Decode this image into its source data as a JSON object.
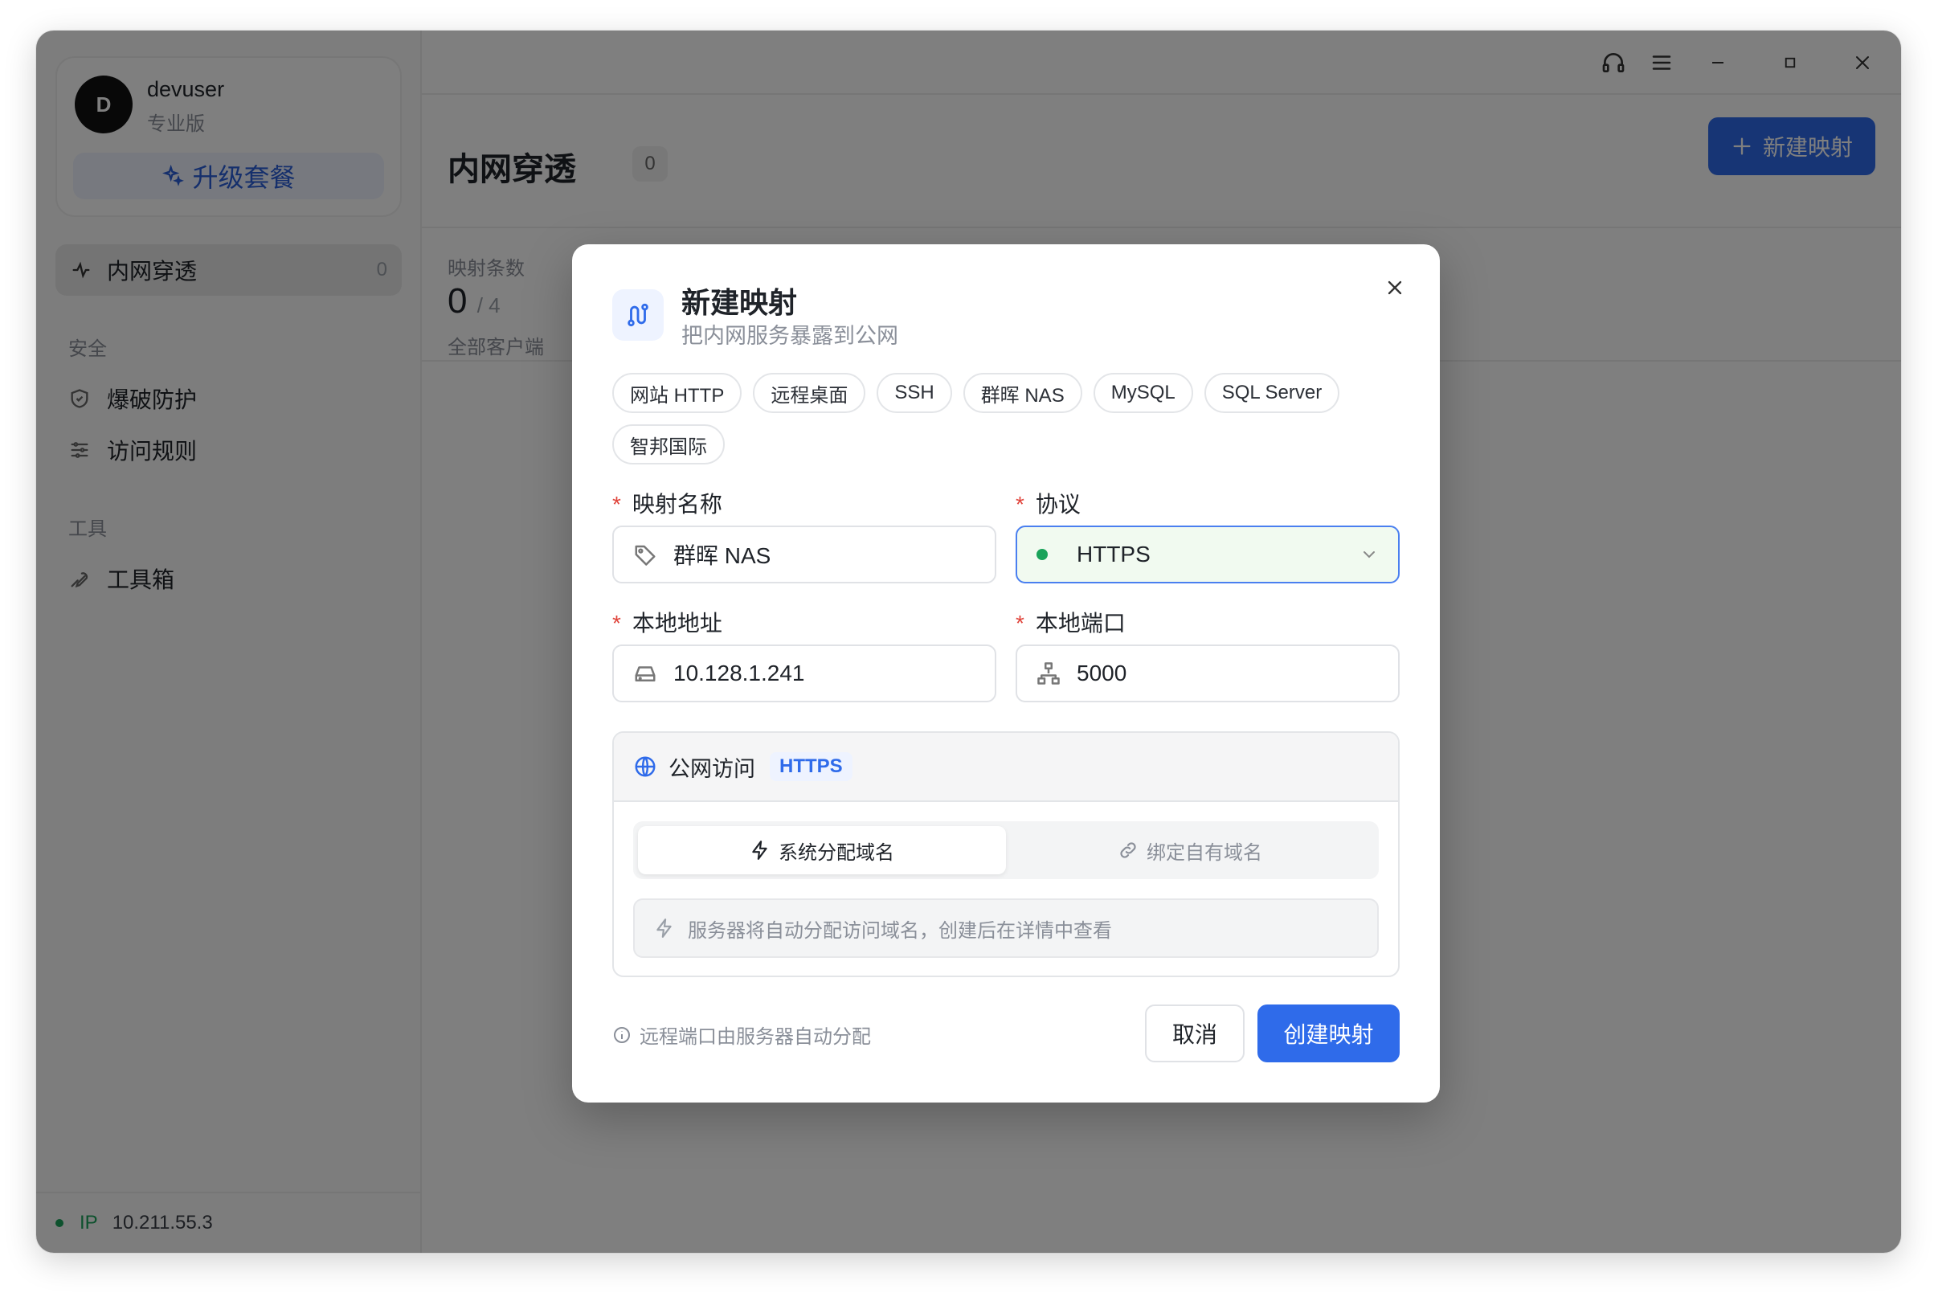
{
  "user": {
    "avatar_letter": "D",
    "name": "devuser",
    "plan": "专业版",
    "upgrade_label": "升级套餐"
  },
  "sidebar": {
    "active_item": {
      "label": "内网穿透",
      "count": "0"
    },
    "sections": [
      {
        "title": "安全",
        "items": [
          {
            "label": "爆破防护",
            "icon": "shield-icon"
          },
          {
            "label": "访问规则",
            "icon": "sliders-icon"
          }
        ]
      },
      {
        "title": "工具",
        "items": [
          {
            "label": "工具箱",
            "icon": "wrench-icon"
          }
        ]
      }
    ],
    "footer": {
      "ip_label": "IP",
      "ip_value": "10.211.55.3"
    }
  },
  "page": {
    "title": "内网穿透",
    "count": "0",
    "new_button": "新建映射",
    "stats": {
      "label": "映射条数",
      "value": "0",
      "of": "/ 4",
      "sub": "全部客户端"
    }
  },
  "modal": {
    "title": "新建映射",
    "subtitle": "把内网服务暴露到公网",
    "presets": [
      "网站 HTTP",
      "远程桌面",
      "SSH",
      "群晖 NAS",
      "MySQL",
      "SQL Server",
      "智邦国际"
    ],
    "fields": {
      "name_label": "映射名称",
      "name_value": "群晖 NAS",
      "protocol_label": "协议",
      "protocol_value": "HTTPS",
      "addr_label": "本地地址",
      "addr_value": "10.128.1.241",
      "port_label": "本地端口",
      "port_value": "5000"
    },
    "public": {
      "title": "公网访问",
      "protocol_tag": "HTTPS",
      "tab_system": "系统分配域名",
      "tab_custom": "绑定自有域名",
      "note": "服务器将自动分配访问域名，创建后在详情中查看"
    },
    "hint": "远程端口由服务器自动分配",
    "cancel": "取消",
    "create": "创建映射"
  },
  "colors": {
    "accent": "#2f6bea",
    "status_green": "#1aa35a",
    "required": "#e0443b"
  }
}
